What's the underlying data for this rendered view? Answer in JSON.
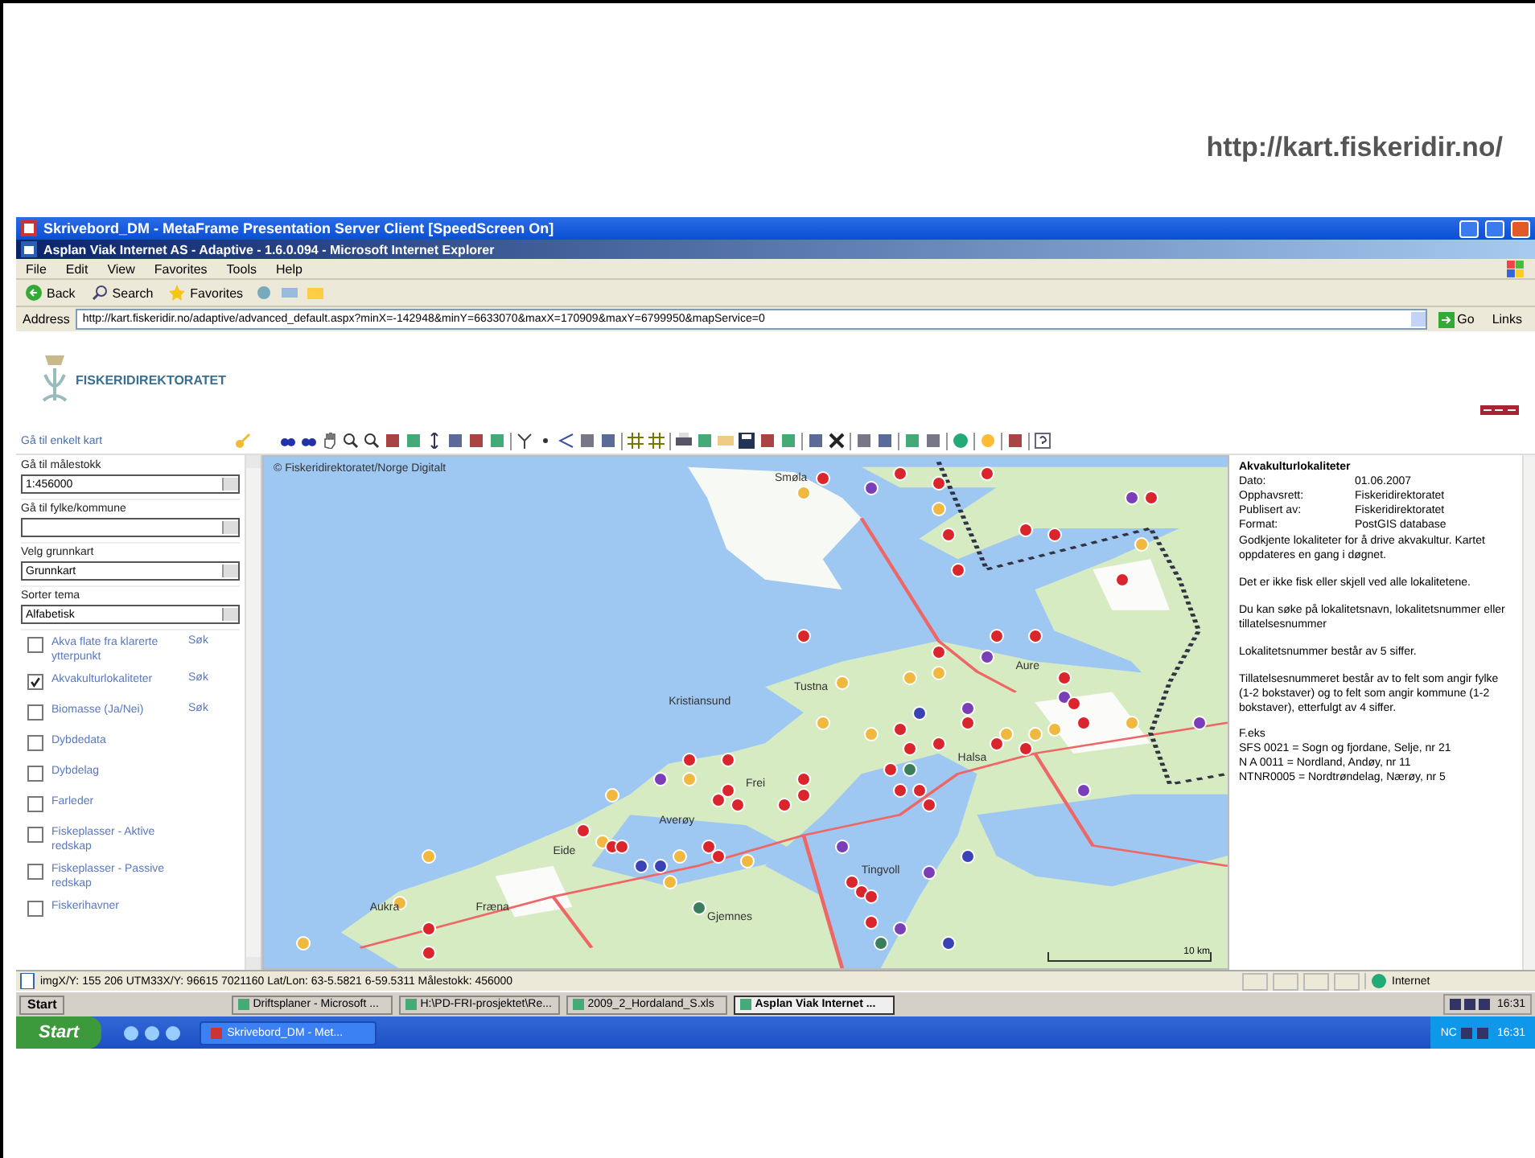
{
  "slide": {
    "url": "http://kart.fiskeridir.no/"
  },
  "citrix_window": {
    "title": "Skrivebord_DM - MetaFrame Presentation Server Client [SpeedScreen On]"
  },
  "browser": {
    "title": "Asplan Viak Internet AS - Adaptive - 1.6.0.094 - Microsoft Internet Explorer",
    "menu": [
      "File",
      "Edit",
      "View",
      "Favorites",
      "Tools",
      "Help"
    ],
    "toolbar": [
      {
        "kind": "back",
        "label": "Back"
      },
      {
        "kind": "search",
        "label": "Search"
      },
      {
        "kind": "favorites",
        "label": "Favorites"
      }
    ],
    "address_label": "Address",
    "address": "http://kart.fiskeridir.no/adaptive/advanced_default.aspx?minX=-142948&minY=6633070&maxX=170909&maxY=6799950&mapService=0",
    "go": "Go",
    "links": "Links"
  },
  "page": {
    "logo_text": "FISKERIDIREKTORATET",
    "map_link": "Gå til enkelt kart",
    "controls": [
      {
        "label": "Gå til målestokk",
        "value": "1:456000"
      },
      {
        "label": "Gå til fylke/kommune"
      },
      {
        "label": "Velg grunnkart",
        "value": "Grunnkart"
      },
      {
        "label": "Sorter tema",
        "value": "Alfabetisk"
      }
    ],
    "layers": [
      {
        "label": "Akva flate fra klarerte ytterpunkt",
        "checked": false,
        "search": "Søk"
      },
      {
        "label": "Akvakulturlokaliteter",
        "checked": true,
        "search": "Søk"
      },
      {
        "label": "Biomasse (Ja/Nei)",
        "checked": false,
        "search": "Søk"
      },
      {
        "label": "Dybdedata",
        "checked": false
      },
      {
        "label": "Dybdelag",
        "checked": false
      },
      {
        "label": "Farleder",
        "checked": false
      },
      {
        "label": "Fiskeplasser - Aktive redskap",
        "checked": false
      },
      {
        "label": "Fiskeplasser - Passive redskap",
        "checked": false
      },
      {
        "label": "Fiskerihavner",
        "checked": false
      }
    ],
    "map": {
      "copyright": "© Fiskeridirektoratet/Norge Digitalt",
      "places": [
        "Smøla",
        "Kristiansund",
        "Tustna",
        "Aure",
        "Halsa",
        "Averøy",
        "Frei",
        "Eide",
        "Aukra",
        "Fræna",
        "Tingvoll",
        "Gjemnes"
      ],
      "scale_label": "10 km"
    },
    "info": {
      "title": "Akvakulturlokaliteter",
      "fields": [
        {
          "label": "Dato:",
          "value": "01.06.2007"
        },
        {
          "label": "Opphavsrett:",
          "value": "Fiskeridirektoratet"
        },
        {
          "label": "Publisert av:",
          "value": "Fiskeridirektoratet"
        },
        {
          "label": "Format:",
          "value": "PostGIS database"
        }
      ],
      "paragraphs": [
        "Godkjente lokaliteter for å drive akvakultur. Kartet oppdateres en gang i døgnet.",
        "Det er ikke fisk eller skjell ved alle lokalitetene.",
        "Du kan søke på lokalitetsnavn, lokalitetsnummer eller tillatelsesnummer",
        "Lokalitetsnummer består av 5 siffer.",
        "Tillatelsesnummeret består av to felt som angir fylke (1-2 bokstaver) og to felt som angir kommune (1-2 bokstaver), etterfulgt av 4 siffer."
      ],
      "example_label": "F.eks",
      "examples": [
        "SFS 0021 = Sogn og fjordane, Selje, nr 21",
        "N A 0011 = Nordland, Andøy, nr 11",
        "NTNR0005 = Nordtrøndelag, Nærøy, nr 5"
      ]
    }
  },
  "status_bar": {
    "text": "imgX/Y: 155 206 UTM33X/Y: 96615 7021160 Lat/Lon: 63-5.5821 6-59.5311 Målestokk: 456000",
    "zone": "Internet"
  },
  "inner_taskbar": {
    "start": "Start",
    "tasks": [
      {
        "label": "Driftsplaner - Microsoft ...",
        "selected": false
      },
      {
        "label": "H:\\PD-FRI-prosjektet\\Re...",
        "selected": false
      },
      {
        "label": "2009_2_Hordaland_S.xls",
        "selected": false
      },
      {
        "label": "Asplan Viak Internet ...",
        "selected": true
      }
    ],
    "clock": "16:31"
  },
  "outer_taskbar": {
    "start": "Start",
    "tasks": [
      {
        "label": "Skrivebord_DM - Met...",
        "selected": false
      }
    ],
    "tray": "NC",
    "clock": "16:31"
  }
}
